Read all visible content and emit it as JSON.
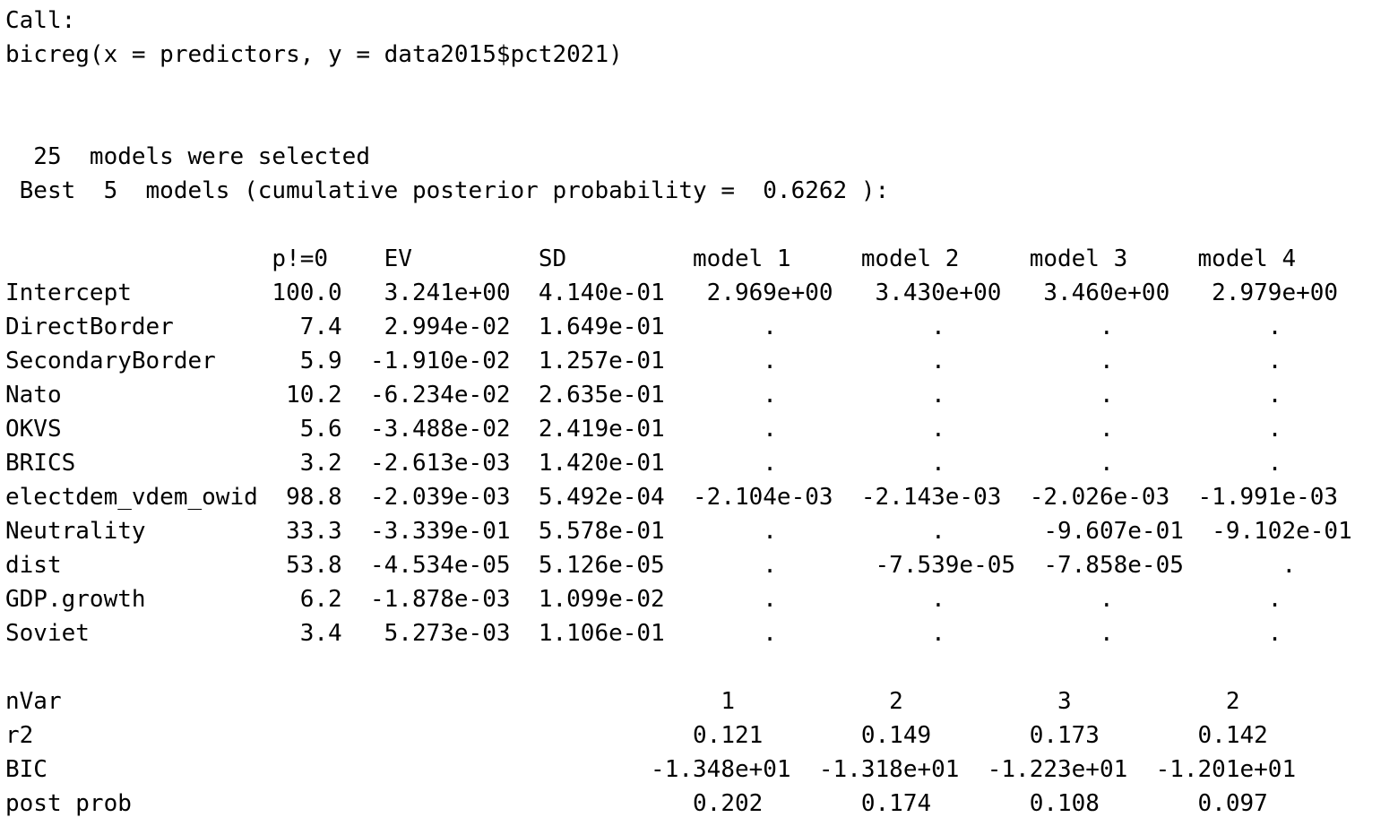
{
  "console": {
    "lines": [
      "Call:",
      "bicreg(x = predictors, y = data2015$pct2021)",
      "",
      "",
      "  25  models were selected",
      " Best  5  models (cumulative posterior probability =  0.6262 ):",
      "",
      "                   p!=0    EV         SD         model 1     model 2     model 3     model 4",
      "Intercept          100.0   3.241e+00  4.140e-01   2.969e+00   3.430e+00   3.460e+00   2.979e+00",
      "DirectBorder         7.4   2.994e-02  1.649e-01       .           .           .           .    ",
      "SecondaryBorder      5.9  -1.910e-02  1.257e-01       .           .           .           .    ",
      "Nato                10.2  -6.234e-02  2.635e-01       .           .           .           .    ",
      "OKVS                 5.6  -3.488e-02  2.419e-01       .           .           .           .    ",
      "BRICS                3.2  -2.613e-03  1.420e-01       .           .           .           .    ",
      "electdem_vdem_owid  98.8  -2.039e-03  5.492e-04  -2.104e-03  -2.143e-03  -2.026e-03  -1.991e-03",
      "Neutrality          33.3  -3.339e-01  5.578e-01       .           .       -9.607e-01  -9.102e-01",
      "dist                53.8  -4.534e-05  5.126e-05       .       -7.539e-05  -7.858e-05       .    ",
      "GDP.growth           6.2  -1.878e-03  1.099e-02       .           .           .           .    ",
      "Soviet               3.4   5.273e-03  1.106e-01       .           .           .           .    ",
      "",
      "nVar                                               1           2           3           2     ",
      "r2                                               0.121       0.149       0.173       0.142   ",
      "BIC                                           -1.348e+01  -1.318e+01  -1.223e+01  -1.201e+01",
      "post prob                                        0.202       0.174       0.108       0.097   "
    ]
  }
}
